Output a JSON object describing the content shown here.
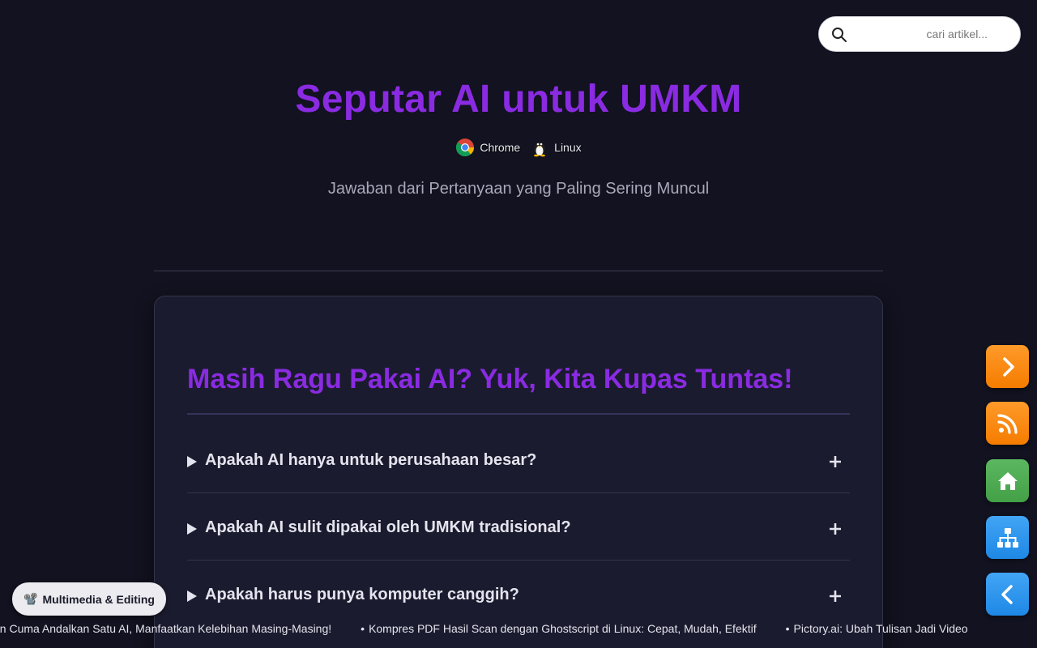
{
  "search": {
    "placeholder": "cari artikel..."
  },
  "header": {
    "title": "Seputar AI untuk UMKM",
    "tags": [
      {
        "label": "Chrome",
        "icon": "chrome-icon"
      },
      {
        "label": "Linux",
        "icon": "linux-tux-icon"
      }
    ],
    "subtitle": "Jawaban dari Pertanyaan yang Paling Sering Muncul"
  },
  "faq": {
    "heading": "Masih Ragu Pakai AI? Yuk, Kita Kupas Tuntas!",
    "items": [
      {
        "question": "Apakah AI hanya untuk perusahaan besar?"
      },
      {
        "question": "Apakah AI sulit dipakai oleh UMKM tradisional?"
      },
      {
        "question": "Apakah harus punya komputer canggih?"
      }
    ]
  },
  "side_nav": [
    {
      "name": "next-icon",
      "color": "#f57c00"
    },
    {
      "name": "rss-icon",
      "color": "#f57c00"
    },
    {
      "name": "home-icon",
      "color": "#43a047"
    },
    {
      "name": "sitemap-icon",
      "color": "#1e88e5"
    },
    {
      "name": "back-icon",
      "color": "#1e88e5"
    }
  ],
  "category_chip": {
    "icon": "📽️",
    "label": "Multimedia & Editing"
  },
  "ticker": {
    "items": [
      "an Cuma Andalkan Satu AI, Manfaatkan Kelebihan Masing-Masing!",
      "Kompres PDF Hasil Scan dengan Ghostscript di Linux: Cepat, Mudah, Efektif",
      "Pictory.ai: Ubah Tulisan Jadi Video"
    ]
  },
  "colors": {
    "background": "#121220",
    "accent_purple": "#8a2be2",
    "card": "#1b1b2f"
  }
}
